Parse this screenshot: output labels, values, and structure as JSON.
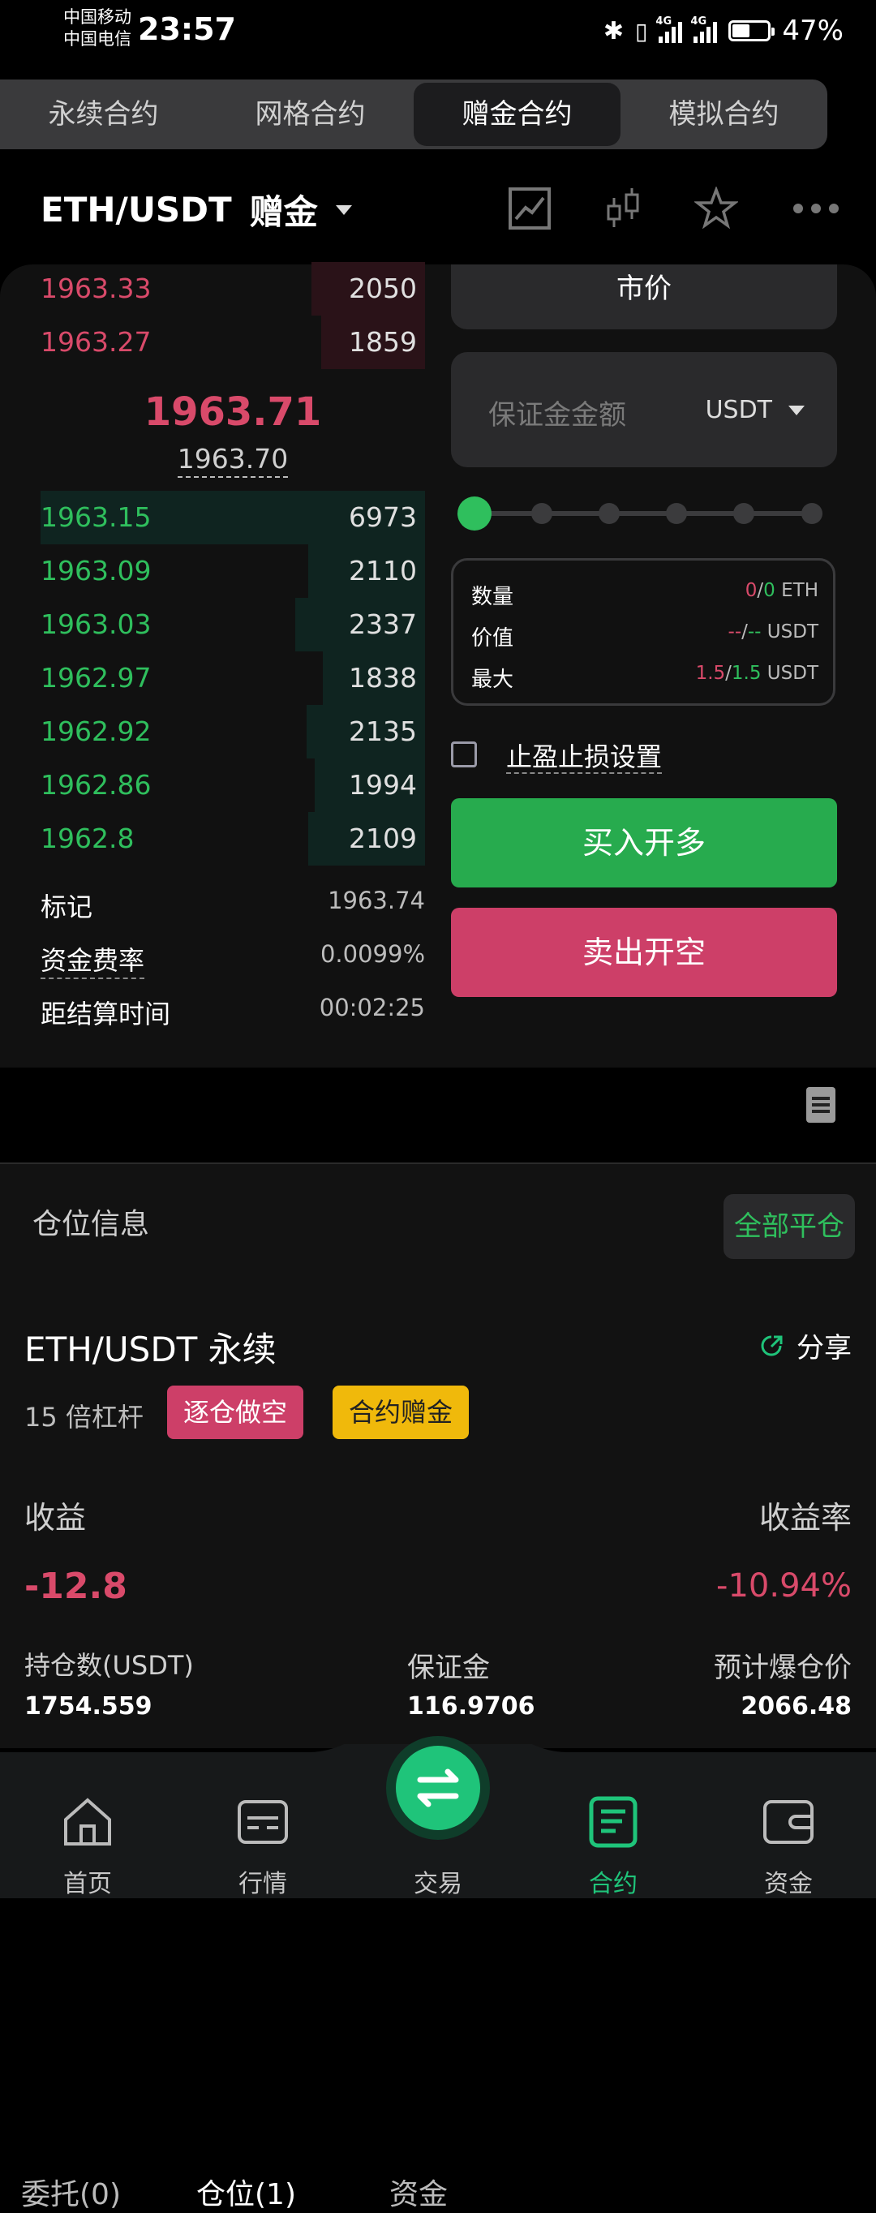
{
  "status_bar": {
    "carrier1": "中国移动",
    "carrier2": "中国电信",
    "time": "23:57",
    "net1": "4G",
    "net2": "4G",
    "battery": "47%"
  },
  "mode_tabs": [
    {
      "label": "永续合约"
    },
    {
      "label": "网格合约"
    },
    {
      "label": "赠金合约"
    },
    {
      "label": "模拟合约"
    }
  ],
  "header": {
    "pair": "ETH/USDT",
    "badge": "赠金"
  },
  "order_book": {
    "asks": [
      {
        "price": "1963.33",
        "qty": "2050"
      },
      {
        "price": "1963.27",
        "qty": "1859"
      }
    ],
    "last_price": "1963.71",
    "mark_price": "1963.70",
    "bids": [
      {
        "price": "1963.15",
        "qty": "6973"
      },
      {
        "price": "1963.09",
        "qty": "2110"
      },
      {
        "price": "1963.03",
        "qty": "2337"
      },
      {
        "price": "1962.97",
        "qty": "1838"
      },
      {
        "price": "1962.92",
        "qty": "2135"
      },
      {
        "price": "1962.86",
        "qty": "1994"
      },
      {
        "price": "1962.8",
        "qty": "2109"
      }
    ]
  },
  "market_info": {
    "mark_label": "标记",
    "mark_value": "1963.74",
    "funding_label": "资金费率",
    "funding_value": "0.0099%",
    "settle_label": "距结算时间",
    "settle_value": "00:02:25"
  },
  "order_form": {
    "order_type": "市价",
    "margin_placeholder": "保证金金额",
    "currency": "USDT",
    "summary": {
      "qty_label": "数量",
      "qty_a": "0",
      "qty_b": "0",
      "qty_unit": "ETH",
      "value_label": "价值",
      "value_a": "--",
      "value_b": "--",
      "value_unit": "USDT",
      "max_label": "最大",
      "max_a": "1.5",
      "max_b": "1.5",
      "max_unit": "USDT"
    },
    "tpsl_label": "止盈止损设置",
    "buy_label": "买入开多",
    "sell_label": "卖出开空"
  },
  "position_tabs": {
    "orders": "委托(0)",
    "positions": "仓位(1)",
    "assets": "资金"
  },
  "position": {
    "section_title": "仓位信息",
    "close_all": "全部平仓",
    "title": "ETH/USDT 永续",
    "share": "分享",
    "leverage": "15 倍杠杆",
    "tag_short": "逐仓做空",
    "tag_bonus": "合约赠金",
    "pnl_label": "收益",
    "pnl_rate_label": "收益率",
    "pnl": "-12.8",
    "pnl_rate": "-10.94%",
    "size_label": "持仓数(USDT)",
    "margin_label": "保证金",
    "liq_label": "预计爆仓价",
    "size": "1754.559",
    "margin": "116.9706",
    "liq": "2066.48"
  },
  "bottom_nav": [
    {
      "label": "首页"
    },
    {
      "label": "行情"
    },
    {
      "label": "交易"
    },
    {
      "label": "合约"
    },
    {
      "label": "资金"
    }
  ],
  "colors": {
    "up": "#2fbf5d",
    "down": "#d94a6a",
    "accent": "#1fc47a",
    "bonus": "#f0b90b"
  }
}
